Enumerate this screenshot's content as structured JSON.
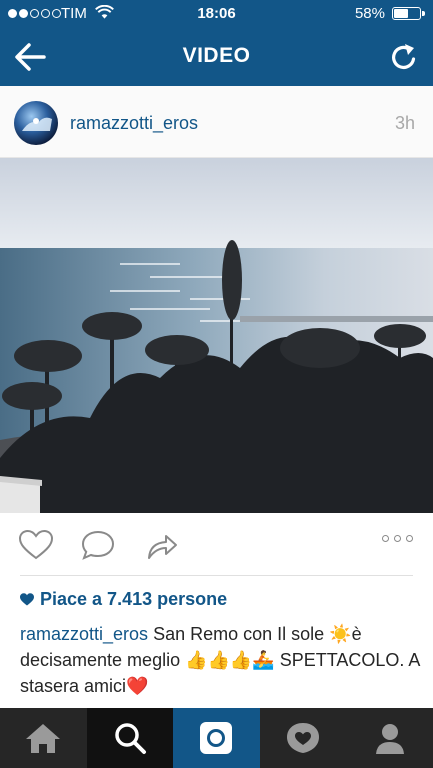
{
  "status_bar": {
    "carrier": "TIM",
    "time": "18:06",
    "battery": "58%",
    "battery_level": 0.58
  },
  "header": {
    "title": "VIDEO"
  },
  "post": {
    "username": "ramazzotti_eros",
    "time_ago": "3h",
    "likes": "Piace a 7.413 persone",
    "caption_user": "ramazzotti_eros",
    "caption_text": " San Remo con Il sole ☀️è decisamente meglio 👍👍👍🚣 SPETTACOLO. A stasera amici❤️"
  },
  "colors": {
    "brand_blue": "#125688",
    "tabbar": "#262626"
  },
  "icons": {
    "back": "arrow-left-icon",
    "refresh": "refresh-icon",
    "like": "heart-outline-icon",
    "comment": "comment-bubble-icon",
    "share": "share-arrow-icon",
    "more": "ellipsis-icon",
    "tabs": [
      "home-icon",
      "search-icon",
      "camera-icon",
      "activity-heart-icon",
      "profile-icon"
    ]
  }
}
